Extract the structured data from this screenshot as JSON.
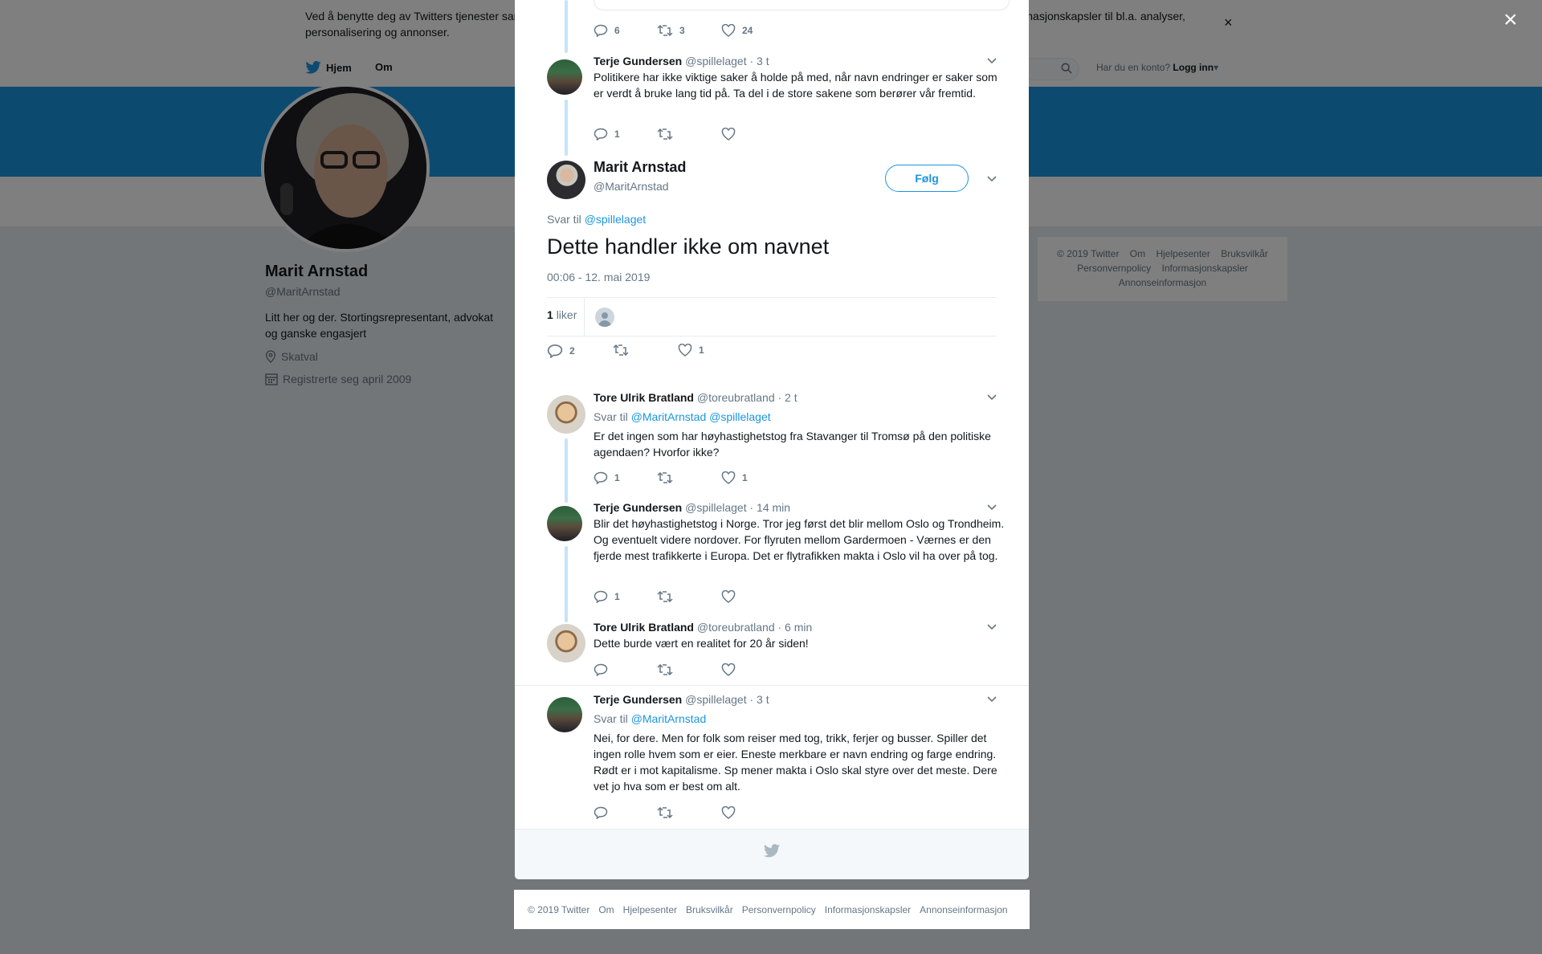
{
  "cookie_bar": {
    "text": "Ved å benytte deg av Twitters tjenester samtykker du i vår bruk av informasjonskapsler. Vi og våre partnere samarbeider globalt og benytter informasjonskapsler til bl.a. analyser, personalisering og annonser.",
    "close_label": "×"
  },
  "nav": {
    "home_label": "Hjem",
    "about_label": "Om",
    "account_prompt": "Har du en konto?",
    "login_label": "Logg inn"
  },
  "profile": {
    "name": "Marit Arnstad",
    "handle": "@MaritArnstad",
    "bio": "Litt her og der. Stortingsrepresentant, advokat og ganske engasjert",
    "location": "Skatval",
    "joined": "Registrerte seg april 2009"
  },
  "side_footer": {
    "items": [
      "© 2019 Twitter",
      "Om",
      "Hjelpesenter",
      "Bruksvilkår",
      "Personvernpolicy",
      "Informasjonskapsler",
      "Annonseinformasjon"
    ]
  },
  "overlay_close": "×",
  "thread_above": [
    {
      "replies": "6",
      "retweets": "3",
      "likes": "24"
    },
    {
      "name": "Terje Gundersen",
      "handle": "@spillelaget",
      "time": "· 3 t",
      "text": "Politikere har ikke viktige saker å holde på med, når navn endringer er saker som er verdt å bruke lang tid på. Ta del i de store sakene som berører vår fremtid.",
      "replies": "1",
      "retweets": "",
      "likes": ""
    }
  ],
  "main_tweet": {
    "name": "Marit Arnstad",
    "handle": "@MaritArnstad",
    "follow_label": "Følg",
    "reply_prefix": "Svar til",
    "reply_to": "@spillelaget",
    "text": "Dette handler ikke om navnet",
    "timestamp": "00:06 - 12. mai 2019",
    "like_count": "1",
    "like_label": "liker",
    "replies": "2",
    "retweets": "",
    "likes": "1"
  },
  "replies": [
    {
      "name": "Tore Ulrik Bratland",
      "handle": "@toreubratland",
      "time": "· 2 t",
      "reply_prefix": "Svar til",
      "reply_to": "@MaritArnstad @spillelaget",
      "text": "Er det ingen som har høyhastighetstog fra Stavanger til Tromsø på den politiske agendaen? Hvorfor ikke?",
      "replies": "1",
      "retweets": "",
      "likes": "1"
    },
    {
      "name": "Terje Gundersen",
      "handle": "@spillelaget",
      "time": "· 14 min",
      "text": "Blir det høyhastighetstog i Norge. Tror jeg først det blir mellom Oslo og Trondheim. Og eventuelt videre nordover. For flyruten mellom Gardermoen - Værnes er den fjerde mest trafikkerte i Europa. Det er flytrafikken makta i Oslo vil ha over på tog.",
      "replies": "1",
      "retweets": "",
      "likes": ""
    },
    {
      "name": "Tore Ulrik Bratland",
      "handle": "@toreubratland",
      "time": "· 6 min",
      "text": "Dette burde vært en realitet for 20 år siden!",
      "replies": "",
      "retweets": "",
      "likes": ""
    },
    {
      "name": "Terje Gundersen",
      "handle": "@spillelaget",
      "time": "· 3 t",
      "reply_prefix": "Svar til",
      "reply_to": "@MaritArnstad",
      "text": "Nei, for dere. Men for folk som reiser med tog, trikk, ferjer og busser. Spiller det ingen rolle hvem som er eier. Eneste merkbare er navn endring og farge endring. Rødt er i mot kapitalisme. Sp mener makta i Oslo skal styre over det meste. Dere vet jo hva som er best om alt.",
      "replies": "",
      "retweets": "",
      "likes": ""
    }
  ],
  "modal_footer": {
    "items": [
      "© 2019 Twitter",
      "Om",
      "Hjelpesenter",
      "Bruksvilkår",
      "Personvernpolicy",
      "Informasjonskapsler",
      "Annonseinformasjon"
    ]
  },
  "colors": {
    "accent": "#1b95e0",
    "thread_line": "#c4e4f9",
    "muted": "#657786"
  }
}
